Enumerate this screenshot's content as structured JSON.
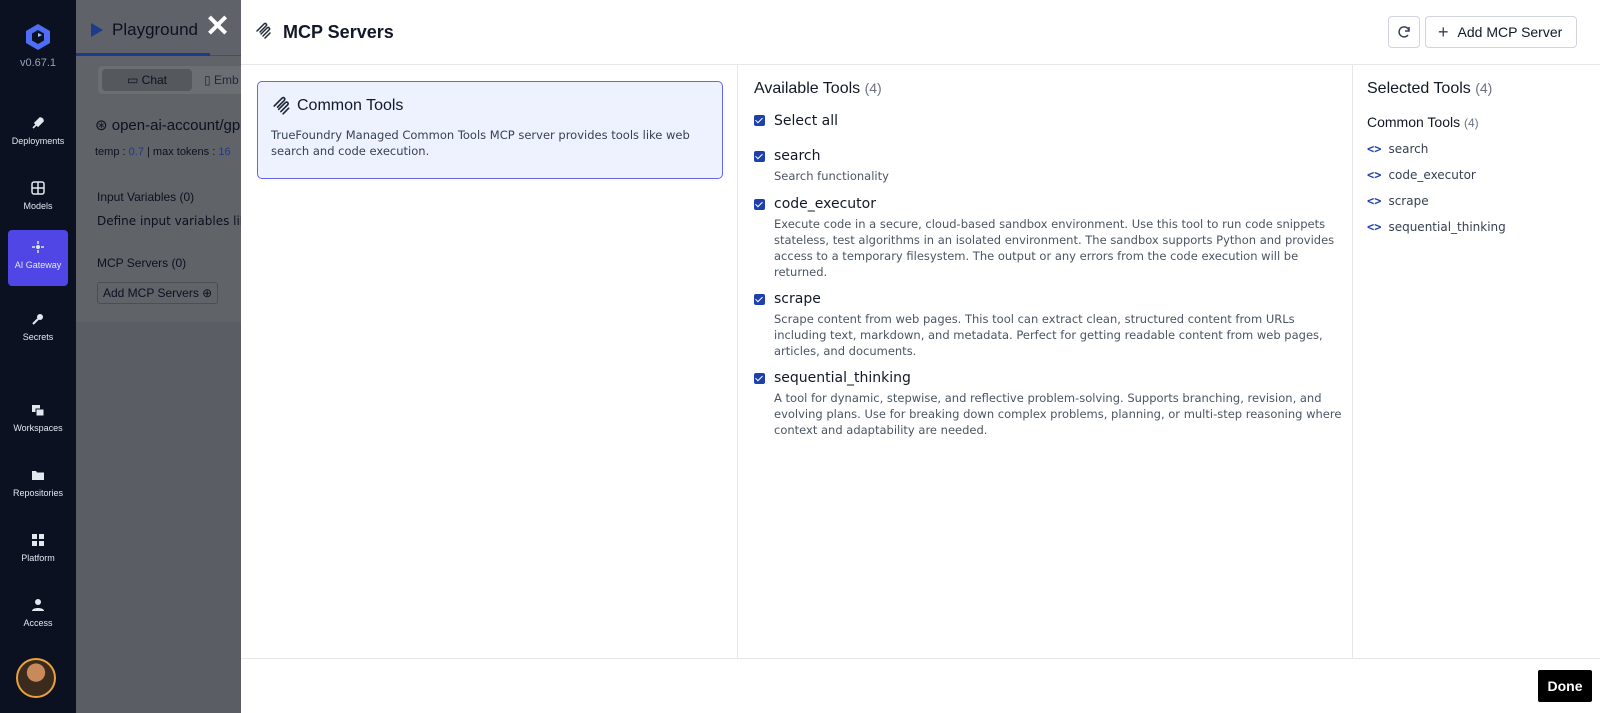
{
  "app": {
    "version": "v0.67.1",
    "nav": [
      {
        "label": "Deployments",
        "icon": "rocket-icon"
      },
      {
        "label": "Models",
        "icon": "grid-icon"
      },
      {
        "label": "AI Gateway",
        "icon": "gateway-icon",
        "active": true
      },
      {
        "label": "Secrets",
        "icon": "key-icon"
      },
      {
        "label": "Workspaces",
        "icon": "workspaces-icon"
      },
      {
        "label": "Repositories",
        "icon": "folder-icon"
      },
      {
        "label": "Platform",
        "icon": "platform-icon"
      },
      {
        "label": "Access",
        "icon": "user-icon"
      }
    ]
  },
  "playground": {
    "tab_label": "Playground",
    "chat_label": "Chat",
    "embed_label": "Emb",
    "model_label": "open-ai-account/gp",
    "temp_label": "temp :",
    "temp_value": "0.7",
    "max_tokens_label": "max tokens :",
    "max_tokens_value": "16",
    "input_vars_title": "Input Variables (0)",
    "input_vars_desc": "Define input variables lik",
    "mcp_title": "MCP Servers (0)",
    "add_mcp_label": "Add MCP Servers"
  },
  "modal": {
    "title": "MCP Servers",
    "add_button": "Add MCP Server",
    "done_button": "Done",
    "server": {
      "name": "Common Tools",
      "description": "TrueFoundry Managed Common Tools MCP server provides tools like web search and code execution."
    },
    "available": {
      "title": "Available Tools",
      "count": "(4)",
      "select_all": "Select all",
      "tools": [
        {
          "name": "search",
          "description": "Search functionality"
        },
        {
          "name": "code_executor",
          "description": "Execute code in a secure, cloud-based sandbox environment. Use this tool to run code snippets stateless, test algorithms in an isolated environment. The sandbox supports Python and provides access to a temporary filesystem. The output or any errors from the code execution will be returned."
        },
        {
          "name": "scrape",
          "description": "Scrape content from web pages. This tool can extract clean, structured content from URLs including text, markdown, and metadata. Perfect for getting readable content from web pages, articles, and documents."
        },
        {
          "name": "sequential_thinking",
          "description": "A tool for dynamic, stepwise, and reflective problem-solving. Supports branching, revision, and evolving plans. Use for breaking down complex problems, planning, or multi-step reasoning where context and adaptability are needed."
        }
      ]
    },
    "selected": {
      "title": "Selected Tools",
      "count": "(4)",
      "group_name": "Common Tools",
      "group_count": "(4)",
      "items": [
        "search",
        "code_executor",
        "scrape",
        "sequential_thinking"
      ]
    }
  }
}
